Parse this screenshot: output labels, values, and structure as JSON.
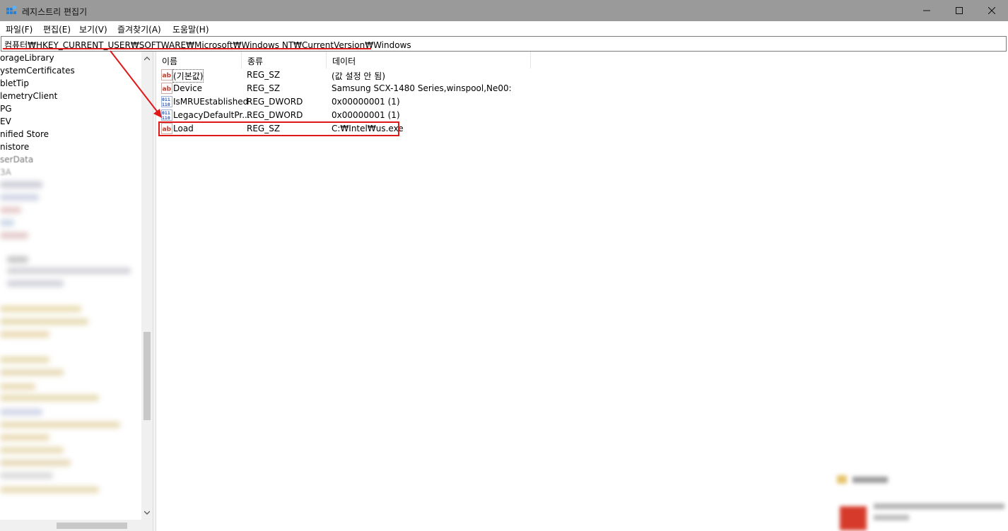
{
  "window": {
    "title": "레지스트리 편집기",
    "controls": {
      "minimize": "minimize",
      "maximize": "maximize",
      "close": "close"
    }
  },
  "menu": [
    "파일(F)",
    "편집(E)",
    "보기(V)",
    "즐겨찾기(A)",
    "도움말(H)"
  ],
  "address": {
    "path": "컴퓨터₩HKEY_CURRENT_USER₩SOFTWARE₩Microsoft₩Windows NT₩CurrentVersion₩Windows"
  },
  "tree": {
    "items": [
      "orageLibrary",
      "ystemCertificates",
      "bletTip",
      "lemetryClient",
      "PG",
      "EV",
      "nified Store",
      "nistore",
      "serData",
      "3A"
    ]
  },
  "list": {
    "columns": [
      "이름",
      "종류",
      "데이터"
    ],
    "rows": [
      {
        "name": "(기본값)",
        "type": "REG_SZ",
        "data": "(값 설정 안 됨)",
        "icon": "string-value-icon"
      },
      {
        "name": "Device",
        "type": "REG_SZ",
        "data": "Samsung SCX-1480 Series,winspool,Ne00:",
        "icon": "string-value-icon"
      },
      {
        "name": "IsMRUEstablished",
        "type": "REG_DWORD",
        "data": "0x00000001 (1)",
        "icon": "dword-value-icon"
      },
      {
        "name": "LegacyDefaultPr...",
        "type": "REG_DWORD",
        "data": "0x00000001 (1)",
        "icon": "dword-value-icon"
      },
      {
        "name": "Load",
        "type": "REG_SZ",
        "data": "C:₩Intel₩us.exe",
        "icon": "string-value-icon"
      }
    ]
  },
  "colors": {
    "annotation": "#e01818",
    "titlebar": "#9a9a9a",
    "string_icon": "#c0392b",
    "dword_icon": "#2a5ab8"
  }
}
